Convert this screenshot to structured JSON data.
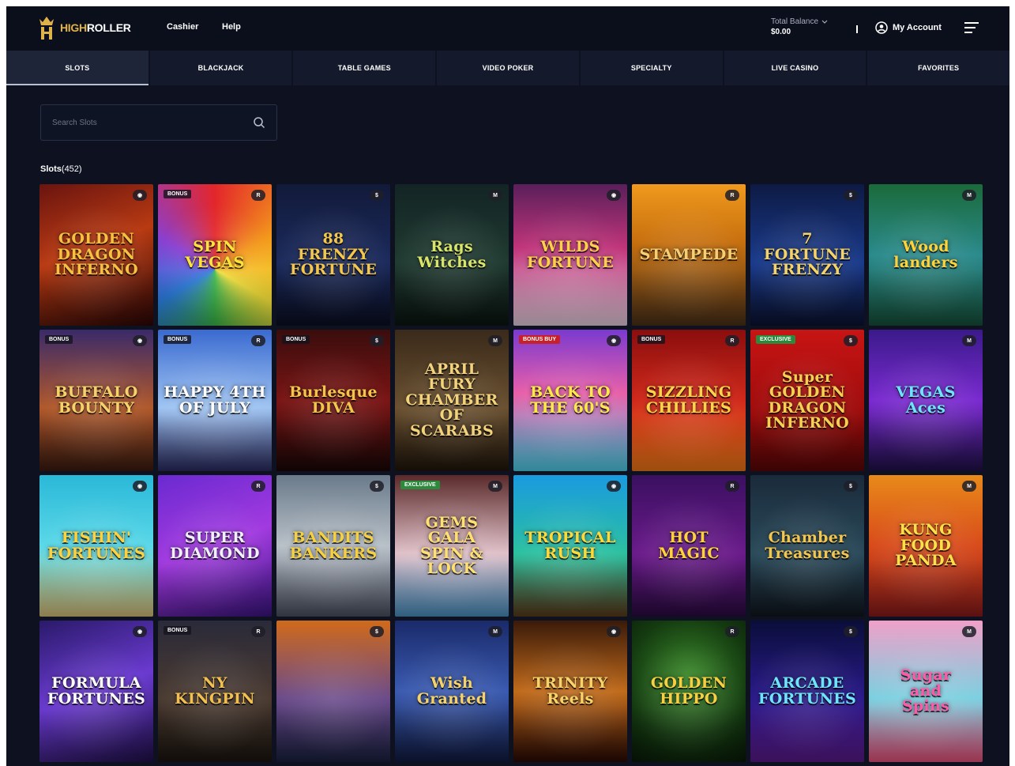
{
  "header": {
    "logo_text_gold": "HIGH",
    "logo_text_white": "ROLLER",
    "nav": [
      {
        "label": "Cashier"
      },
      {
        "label": "Help"
      }
    ],
    "balance_label": "Total Balance",
    "balance_value": "$0.00",
    "account_label": "My Account"
  },
  "tabs": [
    {
      "label": "SLOTS",
      "active": true
    },
    {
      "label": "BLACKJACK",
      "active": false
    },
    {
      "label": "TABLE GAMES",
      "active": false
    },
    {
      "label": "VIDEO POKER",
      "active": false
    },
    {
      "label": "SPECIALTY",
      "active": false
    },
    {
      "label": "LIVE CASINO",
      "active": false
    },
    {
      "label": "FAVORITES",
      "active": false
    }
  ],
  "search": {
    "placeholder": "Search Slots"
  },
  "section": {
    "label": "Slots",
    "count": "(452)"
  },
  "games": [
    {
      "title": "GOLDEN\nDRAGON\nINFERNO",
      "badge": "",
      "bg": "linear-gradient(160deg,#6a1410,#b83a12 45%,#2a0606)",
      "color": "#f6c040"
    },
    {
      "title": "SPIN\nVEGAS",
      "badge": "BONUS",
      "bg": "conic-gradient(from 0deg at 50% 60%,#e3262b,#f39a1c,#f7e23a,#3bbd4a,#2c7ee0,#8a3fd0,#e3262b)",
      "color": "#ffe23a"
    },
    {
      "title": "88\nFRENZY\nFORTUNE",
      "badge": "",
      "bg": "linear-gradient(180deg,#121a3a,#1b2a5c 55%,#0a0e22)",
      "color": "#f3c650"
    },
    {
      "title": "Rags\nWitches",
      "badge": "",
      "bg": "linear-gradient(180deg,#132424,#1f3a30 55%,#0b1410)",
      "color": "#d8e46a"
    },
    {
      "title": "WILDS\nFORTUNE",
      "badge": "",
      "bg": "linear-gradient(180deg,#5a1f5a,#c0347a 45%,#e8d0e0)",
      "color": "#ffd04a"
    },
    {
      "title": "STAMPEDE",
      "badge": "",
      "bg": "linear-gradient(180deg,#f09a1e,#c8700e 40%,#4a3018)",
      "color": "#f6cf73"
    },
    {
      "title": "7\nFORTUNE\nFRENZY",
      "badge": "",
      "bg": "linear-gradient(180deg,#0d1a44,#1a3a8a 55%,#0a1230)",
      "color": "#f3d36a"
    },
    {
      "title": "Wood\nlanders",
      "badge": "",
      "bg": "linear-gradient(180deg,#1b6a3a,#2a8a8c 50%,#16503a)",
      "color": "#ffd23c"
    },
    {
      "title": "BUFFALO\nBOUNTY",
      "badge": "BONUS",
      "bg": "linear-gradient(180deg,#3a2a6a,#b0582a 55%,#3a1a10)",
      "color": "#f6d36a"
    },
    {
      "title": "HAPPY 4TH\nOF JULY",
      "badge": "BONUS",
      "bg": "linear-gradient(180deg,#3a6ad0,#9fc4f2 55%,#2a2a60)",
      "color": "#ffffff"
    },
    {
      "title": "Burlesque\nDIVA",
      "badge": "BONUS",
      "bg": "linear-gradient(180deg,#3a0d0d,#7a1414 50%,#1a0606)",
      "color": "#f5c44a"
    },
    {
      "title": "APRIL FURY\nCHAMBER OF\nSCARABS",
      "badge": "",
      "bg": "linear-gradient(180deg,#3a2a1a,#6a5030 55%,#20160c)",
      "color": "#f2d27a"
    },
    {
      "title": "BACK TO\nTHE 60'S",
      "badge": "BONUS BUY",
      "bg": "linear-gradient(180deg,#7a3ad0,#e85fa8 45%,#4ad0e8)",
      "color": "#ffe94a",
      "badge_style": "red"
    },
    {
      "title": "SIZZLING\nCHILLIES",
      "badge": "BONUS",
      "bg": "linear-gradient(180deg,#8a0e0e,#d0281a 50%,#f07818)",
      "color": "#ffd34a"
    },
    {
      "title": "Super\nGOLDEN\nDRAGON\nINFERNO",
      "badge": "EXCLUSIVE",
      "bg": "linear-gradient(180deg,#c81414,#a00c0c 55%,#5a0606)",
      "color": "#f6d050",
      "badge_style": "green"
    },
    {
      "title": "VEGAS\nAces",
      "badge": "",
      "bg": "linear-gradient(180deg,#3a1a8a,#7a2ad0 50%,#20104a)",
      "color": "#6ee4ff"
    },
    {
      "title": "FISHIN'\nFORTUNES",
      "badge": "",
      "bg": "linear-gradient(180deg,#2ab8d8,#5ad8e8 50%,#d8c078)",
      "color": "#ffd23c"
    },
    {
      "title": "SUPER\nDIAMOND",
      "badge": "",
      "bg": "linear-gradient(160deg,#6a2ad0,#a23ae0 50%,#3a1480)",
      "color": "#f0f0ff"
    },
    {
      "title": "BANDITS\nBANKERS",
      "badge": "",
      "bg": "linear-gradient(180deg,#6a7a8a,#b8c0c8 50%,#4a5060)",
      "color": "#f5d040"
    },
    {
      "title": "GEMS\nGALA\nSPIN & LOCK",
      "badge": "EXCLUSIVE",
      "bg": "linear-gradient(180deg,#5a2a2a,#e0c0c8 55%,#4a90c0)",
      "color": "#ffe070",
      "badge_style": "green"
    },
    {
      "title": "TROPICAL\nRUSH",
      "badge": "",
      "bg": "linear-gradient(180deg,#1a9ae0,#2ac0a0 55%,#5a3a1a)",
      "color": "#ffd83a"
    },
    {
      "title": "HOT\nMAGIC",
      "badge": "",
      "bg": "linear-gradient(180deg,#3a1060,#6a1a8a 55%,#2a0a40)",
      "color": "#ffd23c"
    },
    {
      "title": "Chamber\nTreasures",
      "badge": "",
      "bg": "linear-gradient(180deg,#1a2a3a,#2a4a5a 55%,#10161e)",
      "color": "#f3c650"
    },
    {
      "title": "KUNG FOOD\nPANDA",
      "badge": "",
      "bg": "linear-gradient(180deg,#e88a1a,#d84a1a 50%,#8a1a1a)",
      "color": "#ffe04a"
    },
    {
      "title": "FORMULA\nFORTUNES",
      "badge": "",
      "bg": "linear-gradient(160deg,#2a1a6a,#6a3ad0 50%,#20104a)",
      "color": "#ffffff"
    },
    {
      "title": "NY\nKINGPIN",
      "badge": "BONUS",
      "bg": "linear-gradient(180deg,#2a2a3a,#4a3a30 55%,#1a1410)",
      "color": "#f2c050"
    },
    {
      "title": "",
      "badge": "",
      "bg": "linear-gradient(180deg,#d06a1a,#6a4a8a 55%,#1a2040)",
      "color": "#ffd040"
    },
    {
      "title": "Wish\nGranted",
      "badge": "",
      "bg": "linear-gradient(180deg,#1a2a6a,#3a5ab0 50%,#101a40)",
      "color": "#f5d36a"
    },
    {
      "title": "TRINITY\nReels",
      "badge": "",
      "bg": "linear-gradient(180deg,#3a1a0a,#c06a1a 50%,#2a0a04)",
      "color": "#f7d36a"
    },
    {
      "title": "GOLDEN HIPPO",
      "badge": "",
      "bg": "radial-gradient(circle at 50% 40%,#3a8a2a,#143a10 60%,#081808)",
      "color": "#f6d040"
    },
    {
      "title": "ARCADE\nFORTUNES",
      "badge": "",
      "bg": "linear-gradient(180deg,#0a0e3a,#2a1a8a 55%,#5a1a8a)",
      "color": "#6ee4ff"
    },
    {
      "title": "Sugar\nand\nSpins",
      "badge": "",
      "bg": "linear-gradient(180deg,#f0a0c8,#7ad0e0 55%,#e8507a)",
      "color": "#ff5aa8"
    }
  ]
}
